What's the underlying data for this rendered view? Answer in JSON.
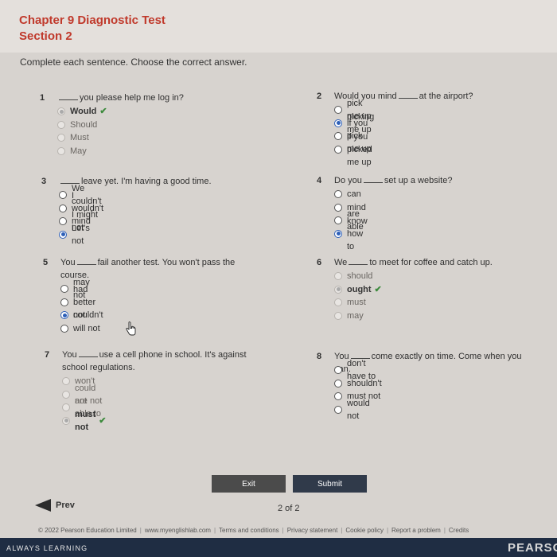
{
  "header": {
    "title": "Chapter 9 Diagnostic Test",
    "subtitle": "Section 2"
  },
  "instructions": "Complete each sentence. Choose the correct answer.",
  "questions": [
    {
      "num": "1",
      "pre": "",
      "post": "you please help me log in?",
      "options": [
        {
          "label": "Would",
          "state": "correct"
        },
        {
          "label": "Should",
          "state": "dim"
        },
        {
          "label": "Must",
          "state": "dim"
        },
        {
          "label": "May",
          "state": "dim"
        }
      ]
    },
    {
      "num": "2",
      "pre": "Would you mind",
      "post": "at the airport?",
      "options": [
        {
          "label": "pick me up",
          "state": "open"
        },
        {
          "label": "picking me up",
          "state": "selected"
        },
        {
          "label": "if you pick me up",
          "state": "open"
        },
        {
          "label": "if you picked me up",
          "state": "open"
        }
      ]
    },
    {
      "num": "3",
      "pre": "",
      "post": "leave yet. I'm having a good time.",
      "options": [
        {
          "label": "We couldn't",
          "state": "open"
        },
        {
          "label": "I wouldn't mind",
          "state": "open"
        },
        {
          "label": "I might not",
          "state": "open"
        },
        {
          "label": "Let's not",
          "state": "selected"
        }
      ]
    },
    {
      "num": "4",
      "pre": "Do you",
      "post": "set up a website?",
      "options": [
        {
          "label": "can",
          "state": "open"
        },
        {
          "label": "mind",
          "state": "open"
        },
        {
          "label": "are able",
          "state": "open"
        },
        {
          "label": "know how to",
          "state": "selected"
        }
      ]
    },
    {
      "num": "5",
      "pre": "You",
      "post": "fail another test. You won't pass the course.",
      "options": [
        {
          "label": "may not",
          "state": "open"
        },
        {
          "label": "had better not",
          "state": "open"
        },
        {
          "label": "couldn't",
          "state": "selected"
        },
        {
          "label": "will not",
          "state": "open"
        }
      ]
    },
    {
      "num": "6",
      "pre": "We",
      "post": "to meet for coffee and catch up.",
      "options": [
        {
          "label": "should",
          "state": "dim"
        },
        {
          "label": "ought",
          "state": "correct"
        },
        {
          "label": "must",
          "state": "dim"
        },
        {
          "label": "may",
          "state": "dim"
        }
      ]
    },
    {
      "num": "7",
      "pre": "You",
      "post": "use a cell phone in school. It's against school regulations.",
      "options": [
        {
          "label": "won't",
          "state": "dim"
        },
        {
          "label": "could not",
          "state": "dim"
        },
        {
          "label": "are not able to",
          "state": "dim"
        },
        {
          "label": "must not",
          "state": "correct"
        }
      ]
    },
    {
      "num": "8",
      "pre": "You",
      "post": "come exactly on time. Come when you can.",
      "options": [
        {
          "label": "don't have to",
          "state": "open"
        },
        {
          "label": "shouldn't",
          "state": "open"
        },
        {
          "label": "must not",
          "state": "open"
        },
        {
          "label": "would not",
          "state": "open"
        }
      ]
    }
  ],
  "buttons": {
    "exit": "Exit",
    "submit": "Submit"
  },
  "nav": {
    "prev": "Prev",
    "page": "2 of 2"
  },
  "footer": {
    "links": [
      "© 2022 Pearson Education Limited",
      "www.myenglishlab.com",
      "Terms and conditions",
      "Privacy statement",
      "Cookie policy",
      "Report a problem",
      "Credits"
    ],
    "tagline": "ALWAYS LEARNING",
    "brand": "PEARSON"
  },
  "colors": {
    "accent": "#c0392b",
    "selected": "#2d5fb8",
    "correct": "#3c8a3c",
    "footer_bg": "#1f2d43"
  }
}
